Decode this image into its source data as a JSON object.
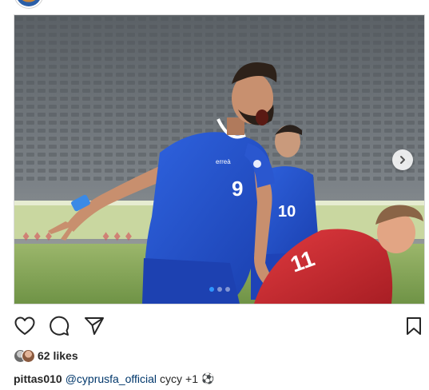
{
  "post": {
    "image_alt": "",
    "jersey_number": "9",
    "opponent_number": "11",
    "brand_text": "erreà",
    "carousel": {
      "dot_count": 3,
      "active_index": 0
    }
  },
  "actions": {
    "like_icon": "heart-icon",
    "comment_icon": "comment-icon",
    "share_icon": "paper-plane-icon",
    "save_icon": "bookmark-icon"
  },
  "likes": {
    "text": "62 likes"
  },
  "caption": {
    "username": "pittas010",
    "mention": "@cyprusfa_official",
    "text": "cycy",
    "extra": "+1",
    "emoji": "⚽"
  },
  "colors": {
    "mention": "#00376b",
    "carousel_active": "#2f96ff",
    "jersey_blue": "#1f4fc9",
    "opponent_red": "#d42f36"
  }
}
